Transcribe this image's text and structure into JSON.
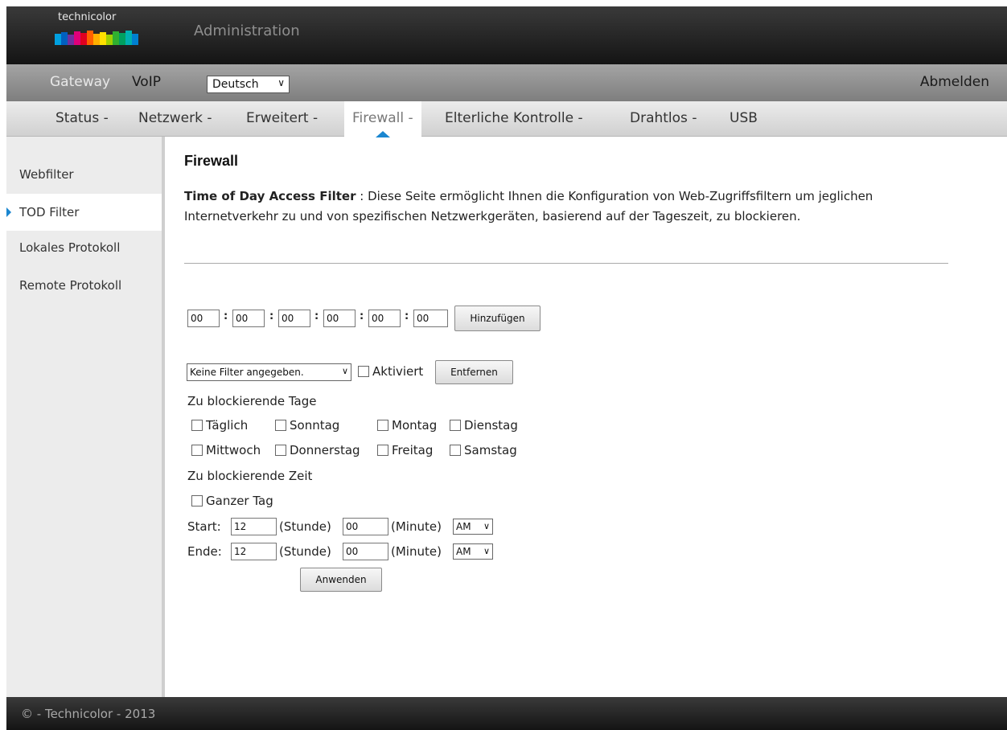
{
  "header": {
    "logo_text": "technicolor",
    "title": "Administration"
  },
  "topnav": {
    "gateway": "Gateway",
    "voip": "VoIP",
    "language": "Deutsch",
    "logout": "Abmelden"
  },
  "tabs": [
    {
      "label": "Status -"
    },
    {
      "label": "Netzwerk -"
    },
    {
      "label": "Erweitert -"
    },
    {
      "label": "Firewall -",
      "active": true
    },
    {
      "label": "Elterliche Kontrolle -"
    },
    {
      "label": "Drahtlos -"
    },
    {
      "label": "USB"
    }
  ],
  "sidebar": {
    "items": [
      {
        "label": "Webfilter"
      },
      {
        "label": "TOD Filter",
        "active": true
      },
      {
        "label": "Lokales Protokoll"
      },
      {
        "label": "Remote Protokoll"
      }
    ]
  },
  "main": {
    "title": "Firewall",
    "desc_bold": "Time of Day Access Filter",
    "desc_text": " :  Diese Seite ermöglicht Ihnen die Konfiguration von Web-Zugriffsfiltern um jeglichen Internetverkehr zu und von spezifischen Netzwerkgeräten, basierend auf der Tageszeit, zu blockieren.",
    "mac_fields": [
      "00",
      "00",
      "00",
      "00",
      "00",
      "00"
    ],
    "add_button": "Hinzufügen",
    "filter_select": "Keine Filter angegeben.",
    "enabled_label": "Aktiviert",
    "remove_button": "Entfernen",
    "days_heading": "Zu blockierende Tage",
    "days": {
      "daily": "Täglich",
      "sunday": "Sonntag",
      "monday": "Montag",
      "tuesday": "Dienstag",
      "wednesday": "Mittwoch",
      "thursday": "Donnerstag",
      "friday": "Freitag",
      "saturday": "Samstag"
    },
    "time_heading": "Zu blockierende Zeit",
    "all_day": "Ganzer Tag",
    "start_label": "Start:",
    "end_label": "Ende:",
    "hour_unit": "(Stunde)",
    "minute_unit": "(Minute)",
    "start_hour": "12",
    "start_minute": "00",
    "start_ampm": "AM",
    "end_hour": "12",
    "end_minute": "00",
    "end_ampm": "AM",
    "apply_button": "Anwenden"
  },
  "footer": {
    "text": "© - Technicolor - 2013"
  },
  "colors": {
    "accent": "#1a86d0",
    "header_dark": "#1a1a1a",
    "sidebar_bg": "#ececec"
  }
}
